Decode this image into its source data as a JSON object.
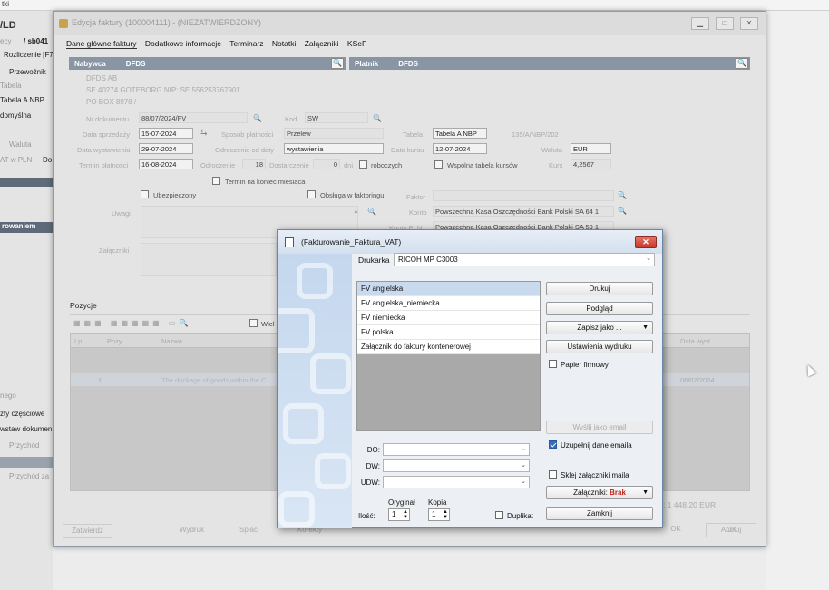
{
  "bg": {
    "top_text": "tki",
    "left_title": "/LD",
    "left_rows": [
      "ecy",
      "Rozliczenie [F7",
      "Przewoźnik",
      "Tabela",
      "Tabela A NBP",
      "domyślna",
      "Waluta",
      "AT w PLN",
      "rowaniem",
      "nego",
      "zty częściowe",
      "wstaw dokumen",
      "Przychód",
      "Przychód za"
    ],
    "left_code": "/ sb041",
    "left_do": "Do"
  },
  "main": {
    "title": "Edycja faktury (100004111) - (NIEZATWIERDZONY)",
    "tabs": [
      "Dane główne faktury",
      "Dodatkowe informacje",
      "Terminarz",
      "Notatki",
      "Załączniki",
      "KSeF"
    ],
    "buyer": {
      "header": "Nabywca",
      "code": "DFDS",
      "line1": "DFDS AB",
      "line2": "SE 40274 GOTEBORG NIP: SE 556253767901",
      "line3": "PO BOX 8978 /"
    },
    "payer": {
      "header": "Płatnik",
      "code": "DFDS"
    },
    "fields": {
      "nr_dokumentu_label": "Nr dokumentu",
      "nr_dokumentu": "88/07/2024/FV",
      "kod_label": "Kod",
      "kod": "SW",
      "data_sprzedazy_label": "Data sprzedaży",
      "data_sprzedazy": "15-07-2024",
      "sposob_label": "Sposób płatności",
      "sposob": "Przelew",
      "data_wystawienia_label": "Data wystawienia",
      "data_wystawienia": "29-07-2024",
      "odroczenie_od_label": "Odroczenie od daty",
      "odroczenie_od": "wystawienia",
      "termin_label": "Termin płatności",
      "termin": "16-08-2024",
      "odroczenie_label": "Odroczenie",
      "odroczenie": "18",
      "dostarczenie_label": "Dostarczenie",
      "dostarczenie": "0",
      "dni": "dni",
      "roboczych": "roboczych",
      "termin_koniec": "Termin na koniec miesiąca",
      "tabela_label": "Tabela",
      "tabela": "Tabela A NBP",
      "tabela_nr": "135/A/NBP/202",
      "data_kursu_label": "Data kursu",
      "data_kursu": "12-07-2024",
      "waluta_label": "Waluta",
      "waluta": "EUR",
      "wspolna": "Wspólna tabela kursów",
      "kurs_label": "Kurs",
      "kurs": "4,2567",
      "ubezpieczony": "Ubezpieczony",
      "faktoring": "Obsługa w faktoringu",
      "faktor_label": "Faktor",
      "konto_label": "Konto",
      "konto": "Powszechna Kasa Oszczędności Bank Polski SA 64 1",
      "konto_pln_label": "Konto PLN",
      "konto_pln": "Powszechna Kasa Oszczędności Bank Polski SA 59 1",
      "uwagi_label": "Uwagi",
      "zalaczniki_label": "Załączniki"
    },
    "pozycje": "Pozycje",
    "wiel": "Wiel",
    "grid": {
      "col_lp": "Lp.",
      "col_pozy": "Pozy",
      "col_nazwa": "Nazwa",
      "col_data": "Data wyst.",
      "row_lp": "1",
      "row_text": "The dockage of goods within the C",
      "row_date": "06/07/2024"
    },
    "total": ": 1 448,20 EUR",
    "bottom": {
      "zatwierdz": "Zatwierdź",
      "wydruk": "Wydruk",
      "splac": "Spłać",
      "korekty": "Korekty",
      "akcje": "Akcje",
      "ok": "OK",
      "anuluj": "Anuluj"
    }
  },
  "dialog": {
    "title": "(Fakturowanie_Faktura_VAT)",
    "printer_label": "Drukarka",
    "printer": "RICOH MP C3003",
    "reports": [
      "FV angielska",
      "FV angielska_niemiecka",
      "FV niemiecka",
      "FV polska",
      "Załącznik do faktury kontenerowej"
    ],
    "selected_index": 0,
    "buttons": {
      "drukuj": "Drukuj",
      "podglad": "Podgląd",
      "zapisz": "Zapisz jako ...",
      "ustawienia": "Ustawienia wydruku",
      "wyslij": "Wyślij jako email",
      "zalaczniki": "Załączniki:",
      "brak": "Brak",
      "zamknij": "Zamknij"
    },
    "papier": "Papier firmowy",
    "uzupelnij": "Uzupełnij dane emaila",
    "sklej": "Sklej załączniki maila",
    "do_label": "DO:",
    "dw_label": "DW:",
    "udw_label": "UDW:",
    "ilosc_label": "Ilość:",
    "oryginal_label": "Oryginał",
    "kopia_label": "Kopia",
    "oryginal": "1",
    "kopia": "1",
    "duplikat": "Duplikat",
    "colors": {
      "brak": "#c0201a",
      "accent": "#2f6fc4"
    }
  }
}
